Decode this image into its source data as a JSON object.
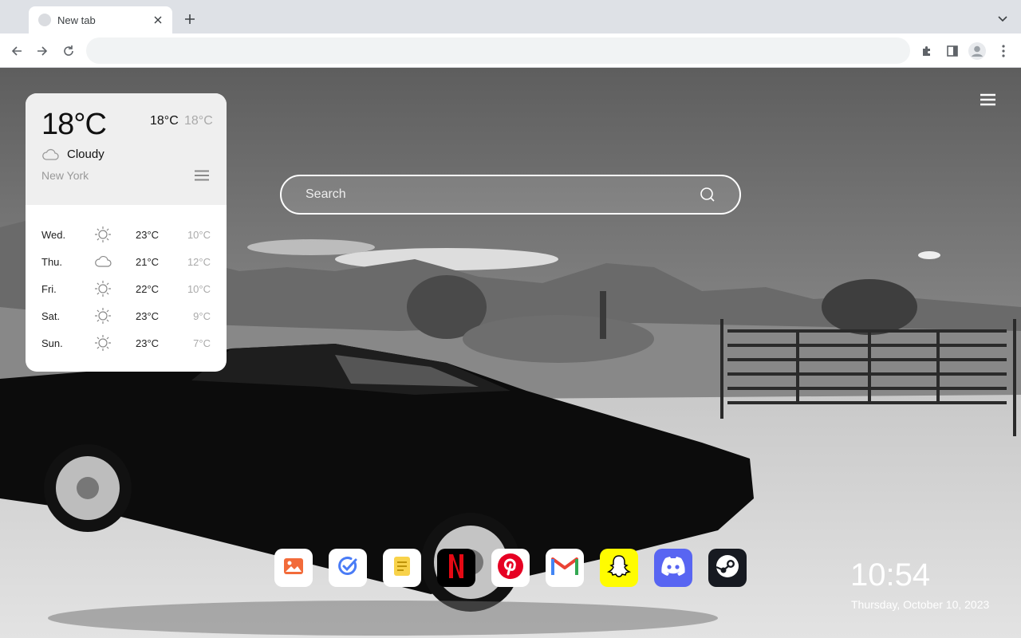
{
  "browser": {
    "tab_title": "New tab",
    "address": ""
  },
  "weather": {
    "current_temp": "18°C",
    "high": "18°C",
    "low": "18°C",
    "condition": "Cloudy",
    "city": "New York",
    "forecast": [
      {
        "day": "Wed.",
        "icon": "sun-icon",
        "high": "23°C",
        "low": "10°C"
      },
      {
        "day": "Thu.",
        "icon": "cloud-icon",
        "high": "21°C",
        "low": "12°C"
      },
      {
        "day": "Fri.",
        "icon": "sun-icon",
        "high": "22°C",
        "low": "10°C"
      },
      {
        "day": "Sat.",
        "icon": "sun-icon",
        "high": "23°C",
        "low": "9°C"
      },
      {
        "day": "Sun.",
        "icon": "sun-icon",
        "high": "23°C",
        "low": "7°C"
      }
    ]
  },
  "search": {
    "placeholder": "Search"
  },
  "dock": {
    "apps": [
      {
        "name": "photos",
        "icon": "image-icon",
        "bg": "#ffffff"
      },
      {
        "name": "tasks",
        "icon": "check-circle-icon",
        "bg": "#ffffff"
      },
      {
        "name": "notes",
        "icon": "notes-icon",
        "bg": "#ffffff"
      },
      {
        "name": "netflix",
        "icon": "netflix-icon",
        "bg": "#000000"
      },
      {
        "name": "pinterest",
        "icon": "pinterest-icon",
        "bg": "#ffffff"
      },
      {
        "name": "gmail",
        "icon": "gmail-icon",
        "bg": "#ffffff"
      },
      {
        "name": "snapchat",
        "icon": "snapchat-icon",
        "bg": "#fffc00"
      },
      {
        "name": "discord",
        "icon": "discord-icon",
        "bg": "#5865f2"
      },
      {
        "name": "steam",
        "icon": "steam-icon",
        "bg": "#171a21"
      }
    ]
  },
  "clock": {
    "time": "10:54",
    "date": "Thursday, October 10, 2023"
  },
  "colors": {
    "tab_strip": "#dee1e6",
    "weather_header": "#efefef"
  }
}
